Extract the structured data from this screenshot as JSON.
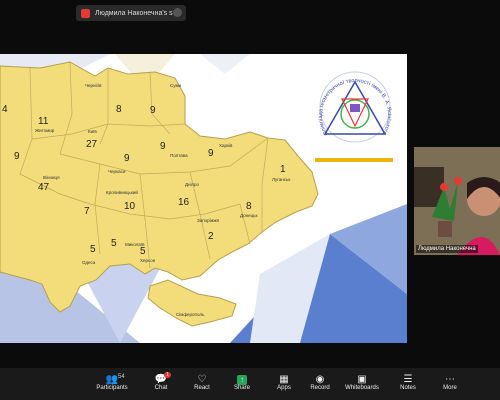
{
  "share_indicator": {
    "label": "Людмила Наконечна's screen"
  },
  "map": {
    "logo_text": "Олімпіада геометричної творчості імені В. А. Ясінського",
    "regions": [
      {
        "name": "",
        "value": "4"
      },
      {
        "name": "Житомир",
        "value": "11"
      },
      {
        "name": "Київ",
        "value": "27"
      },
      {
        "name": "Чернігів",
        "value": "8"
      },
      {
        "name": "Суми",
        "value": "9"
      },
      {
        "name": "Полтава",
        "value": "9"
      },
      {
        "name": "Харків",
        "value": "9"
      },
      {
        "name": "Луганськ",
        "value": "1"
      },
      {
        "name": "",
        "value": "9"
      },
      {
        "name": "Вінниця",
        "value": "47"
      },
      {
        "name": "Черкаси",
        "value": "9"
      },
      {
        "name": "",
        "value": "7"
      },
      {
        "name": "Кропивницький",
        "value": "10"
      },
      {
        "name": "Дніпро",
        "value": "16"
      },
      {
        "name": "Донецьк",
        "value": "8"
      },
      {
        "name": "Запоріжжя",
        "value": "2"
      },
      {
        "name": "Миколаїв",
        "value": "5"
      },
      {
        "name": "Одеса",
        "value": "5"
      },
      {
        "name": "Херсон",
        "value": "5"
      },
      {
        "name": "Сімферополь",
        "value": ""
      }
    ]
  },
  "participant": {
    "name": "Людмила Наконечна"
  },
  "toolbar": {
    "participants": {
      "label": "Participants",
      "count": "54"
    },
    "chat": {
      "label": "Chat",
      "badge": "1"
    },
    "react": {
      "label": "React"
    },
    "share": {
      "label": "Share"
    },
    "apps": {
      "label": "Apps"
    },
    "record": {
      "label": "Record"
    },
    "whiteboards": {
      "label": "Whiteboards"
    },
    "notes": {
      "label": "Notes"
    },
    "more": {
      "label": "More"
    }
  }
}
